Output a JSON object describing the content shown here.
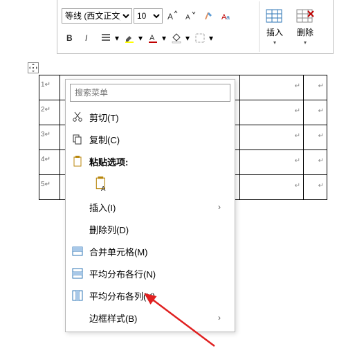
{
  "ribbon": {
    "font_name": "等线 (西文正文)",
    "font_size": "10",
    "insert": "插入",
    "delete": "删除"
  },
  "context": {
    "search_placeholder": "搜索菜单",
    "cut": "剪切(T)",
    "copy": "复制(C)",
    "paste_options": "粘贴选项:",
    "insert": "插入(I)",
    "delete_col": "删除列(D)",
    "merge": "合并单元格(M)",
    "dist_rows": "平均分布各行(N)",
    "dist_cols": "平均分布各列(Y)",
    "border_style": "边框样式(B)"
  },
  "rows": [
    "1",
    "2",
    "3",
    "4",
    "5"
  ]
}
